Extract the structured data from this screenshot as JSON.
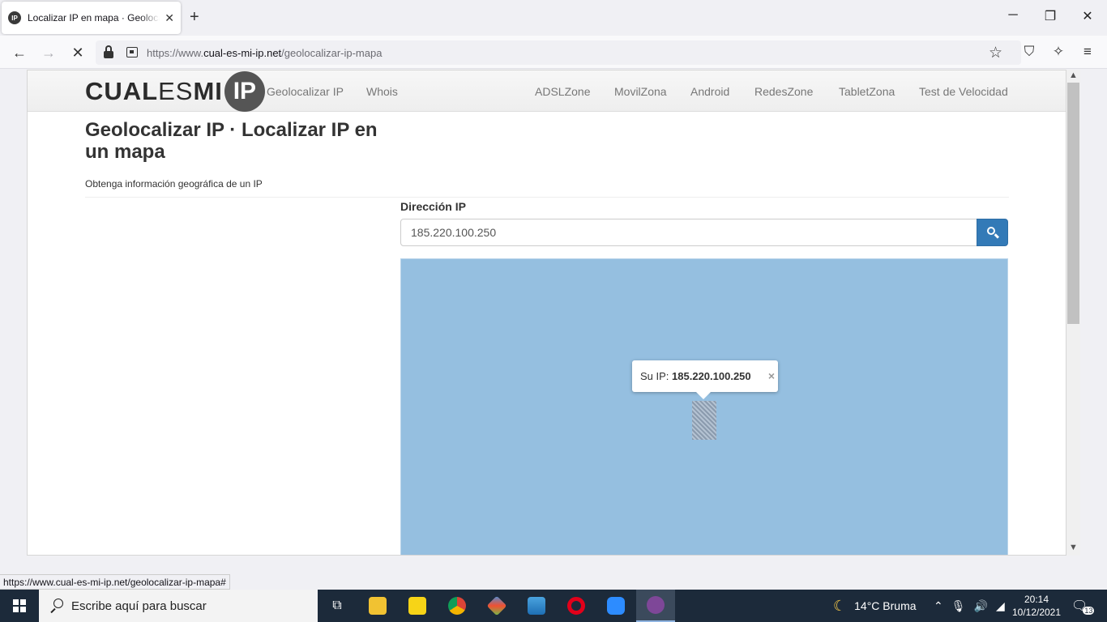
{
  "browser": {
    "tab_title": "Localizar IP en mapa · Geolocalizar IP",
    "tab_favicon": "IP",
    "url_prefix": "https://www.",
    "url_domain": "cual-es-mi-ip.net",
    "url_path": "/geolocalizar-ip-mapa",
    "status_url": "https://www.cual-es-mi-ip.net/geolocalizar-ip-mapa#"
  },
  "site": {
    "logo_bold": "CUAL",
    "logo_light": "ES",
    "logo_bold2": "MI",
    "logo_badge": "IP",
    "nav_left": [
      "Geolocalizar IP",
      "Whois"
    ],
    "nav_right": [
      "ADSLZone",
      "MovilZona",
      "Android",
      "RedesZone",
      "TabletZona",
      "Test de Velocidad"
    ]
  },
  "main": {
    "title": "Geolocalizar IP · Localizar IP en un mapa",
    "subtitle": "Obtenga información geográfica de un IP",
    "ip_label": "Dirección IP",
    "ip_value": "185.220.100.250",
    "popup_prefix": "Su IP:",
    "popup_ip": "185.220.100.250",
    "popup_close": "×"
  },
  "taskbar": {
    "search_placeholder": "Escribe aquí para buscar",
    "weather": "14°C  Bruma",
    "time": "20:14",
    "date": "10/12/2021",
    "notifications": "13"
  },
  "colors": {
    "map_water": "#95bfe0",
    "search_button": "#337ab7",
    "taskbar": "#1c2a3a"
  }
}
